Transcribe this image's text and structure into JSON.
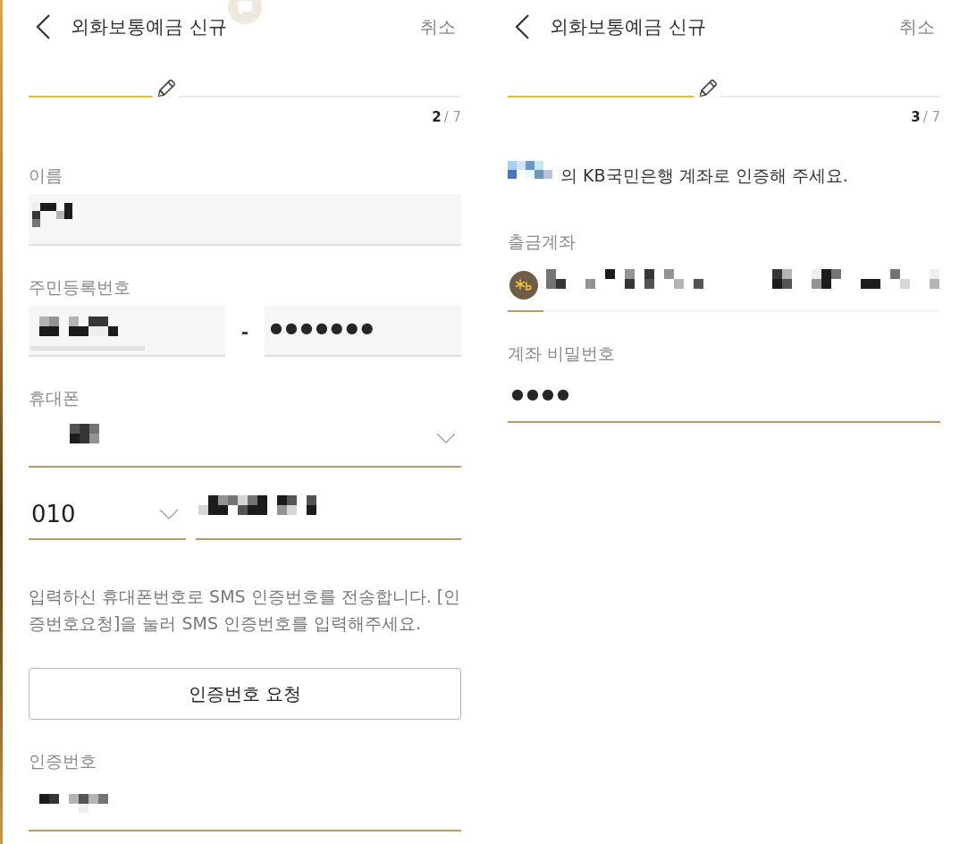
{
  "screens": [
    {
      "header": {
        "title": "외화보통예금 신규",
        "cancel": "취소"
      },
      "chat_button": true,
      "progress": {
        "level": 0.286,
        "step": "2",
        "of": "/ 7"
      },
      "items": [
        {
          "kind": "field",
          "label": "이름",
          "readonly": true
        },
        {
          "kind": "id_number",
          "label": "주민등록번호",
          "readonly": true,
          "separator": "-",
          "masked": "●●●●●●●"
        },
        {
          "kind": "select",
          "label": "휴대폰"
        },
        {
          "kind": "phone",
          "prefix": "010"
        },
        {
          "kind": "notice",
          "text": "입력하신 휴대폰번호로 SMS 인증번호를 전송합니다. [인증번호요청]을 눌러 SMS 인증번호를 입력해주세요."
        },
        {
          "kind": "button",
          "label": "인증번호 요청"
        },
        {
          "kind": "field",
          "label": "인증번호",
          "readonly": false
        }
      ]
    },
    {
      "header": {
        "title": "외화보통예금 신규",
        "cancel": "취소"
      },
      "progress": {
        "level": 0.429,
        "step": "3",
        "of": "/ 7"
      },
      "items": [
        {
          "kind": "greeting",
          "text": "의 KB국민은행 계좌로 인증해 주세요."
        },
        {
          "kind": "account",
          "label": "출금계좌"
        },
        {
          "kind": "password",
          "label": "계좌 비밀번호",
          "masked": "●●●●"
        }
      ]
    }
  ]
}
